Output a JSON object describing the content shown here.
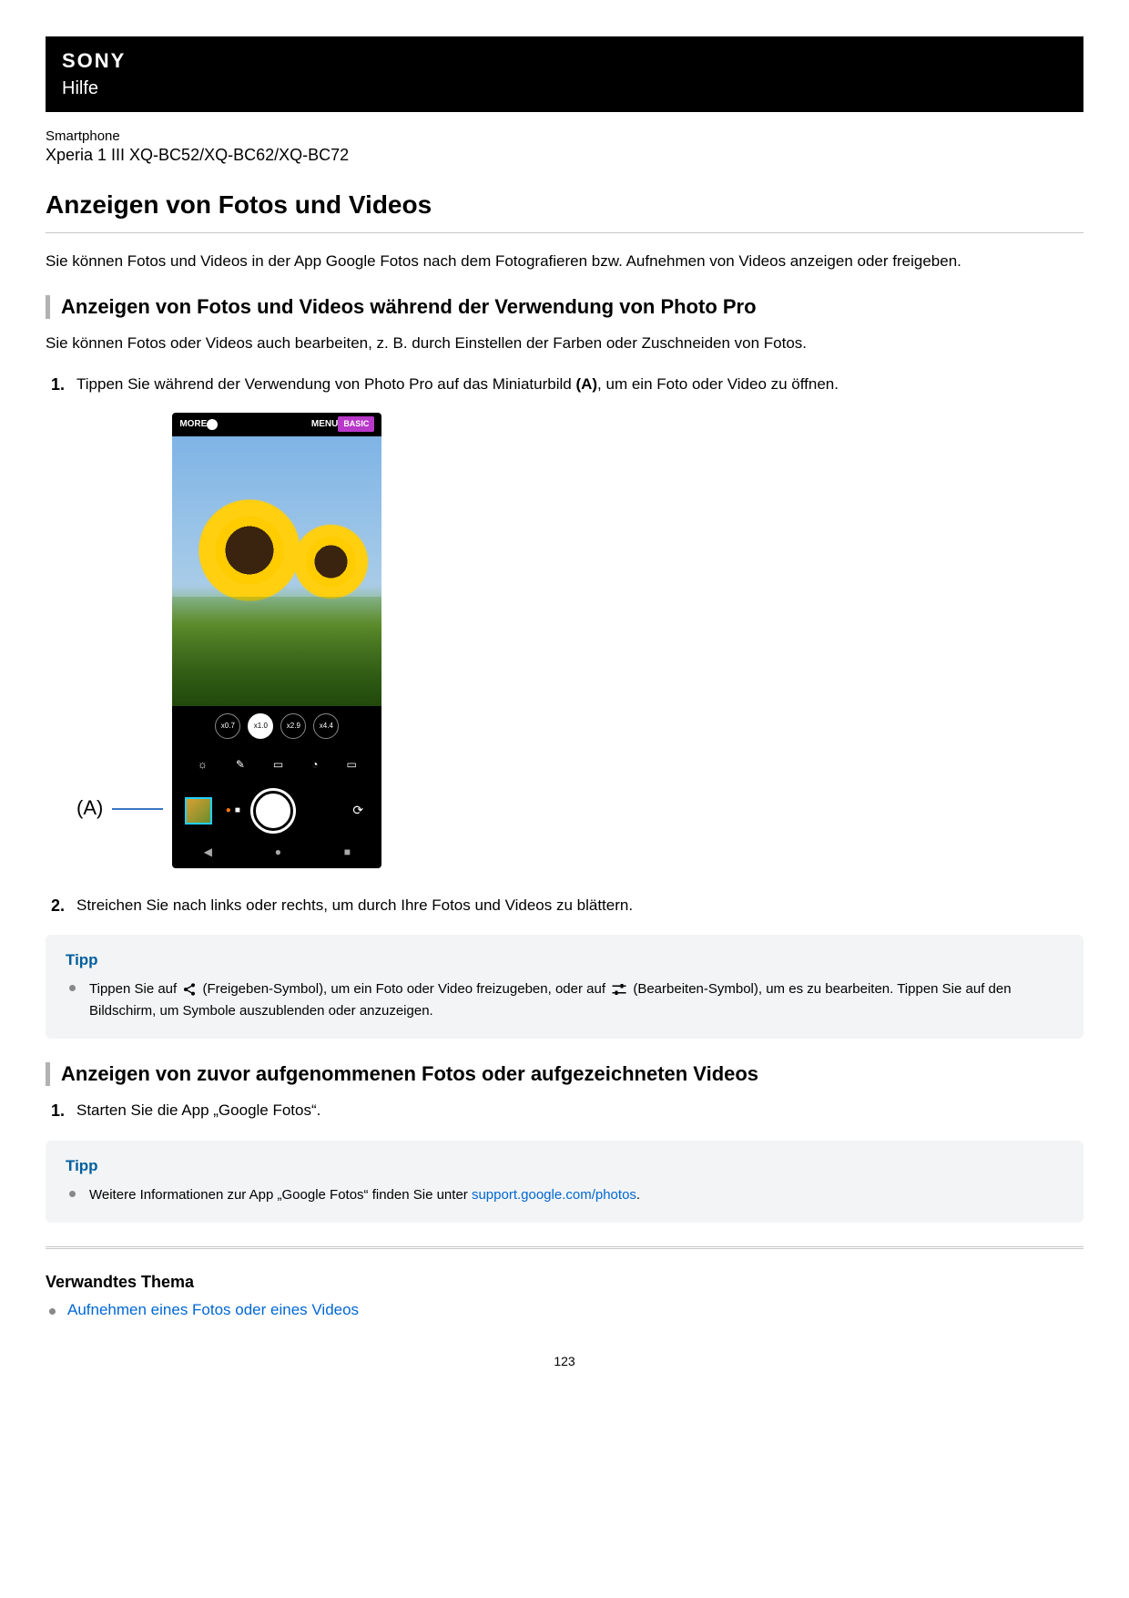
{
  "header": {
    "brand": "SONY",
    "helpLabel": "Hilfe"
  },
  "breadcrumb": "Smartphone",
  "device": "Xperia 1 III XQ-BC52/XQ-BC62/XQ-BC72",
  "title": "Anzeigen von Fotos und Videos",
  "intro": "Sie können Fotos und Videos in der App Google Fotos nach dem Fotografieren bzw. Aufnehmen von Videos anzeigen oder freigeben.",
  "section1": {
    "heading": "Anzeigen von Fotos und Videos während der Verwendung von Photo Pro",
    "paragraph": "Sie können Fotos oder Videos auch bearbeiten, z. B. durch Einstellen der Farben oder Zuschneiden von Fotos.",
    "step1_before": "Tippen Sie während der Verwendung von Photo Pro auf das Miniaturbild ",
    "step1_bold": "(A)",
    "step1_after": ", um ein Foto oder Video zu öffnen.",
    "step2": "Streichen Sie nach links oder rechts, um durch Ihre Fotos und Videos zu blättern."
  },
  "figure": {
    "calloutLabel": "(A)",
    "topbar": {
      "more": "MORE",
      "menu": "MENU",
      "badge": "BASIC"
    },
    "zoom": [
      "x0.7",
      "x1.0",
      "x2.9",
      "x4.4"
    ]
  },
  "tip1": {
    "title": "Tipp",
    "text_part1": "Tippen Sie auf ",
    "shareLabel": " (Freigeben-Symbol), um ein Foto oder Video freizugeben, oder auf ",
    "editLabel": " (Bearbeiten-Symbol), um es zu bearbeiten. Tippen Sie auf den Bildschirm, um Symbole auszublenden oder anzuzeigen."
  },
  "section2": {
    "heading": "Anzeigen von zuvor aufgenommenen Fotos oder aufgezeichneten Videos",
    "step1": "Starten Sie die App „Google Fotos“."
  },
  "tip2": {
    "title": "Tipp",
    "text_before": "Weitere Informationen zur App „Google Fotos“ finden Sie unter ",
    "link_text": "support.google.com/photos",
    "text_after": "."
  },
  "related": {
    "heading": "Verwandtes Thema",
    "link": "Aufnehmen eines Fotos oder eines Videos"
  },
  "pageNumber": "123"
}
